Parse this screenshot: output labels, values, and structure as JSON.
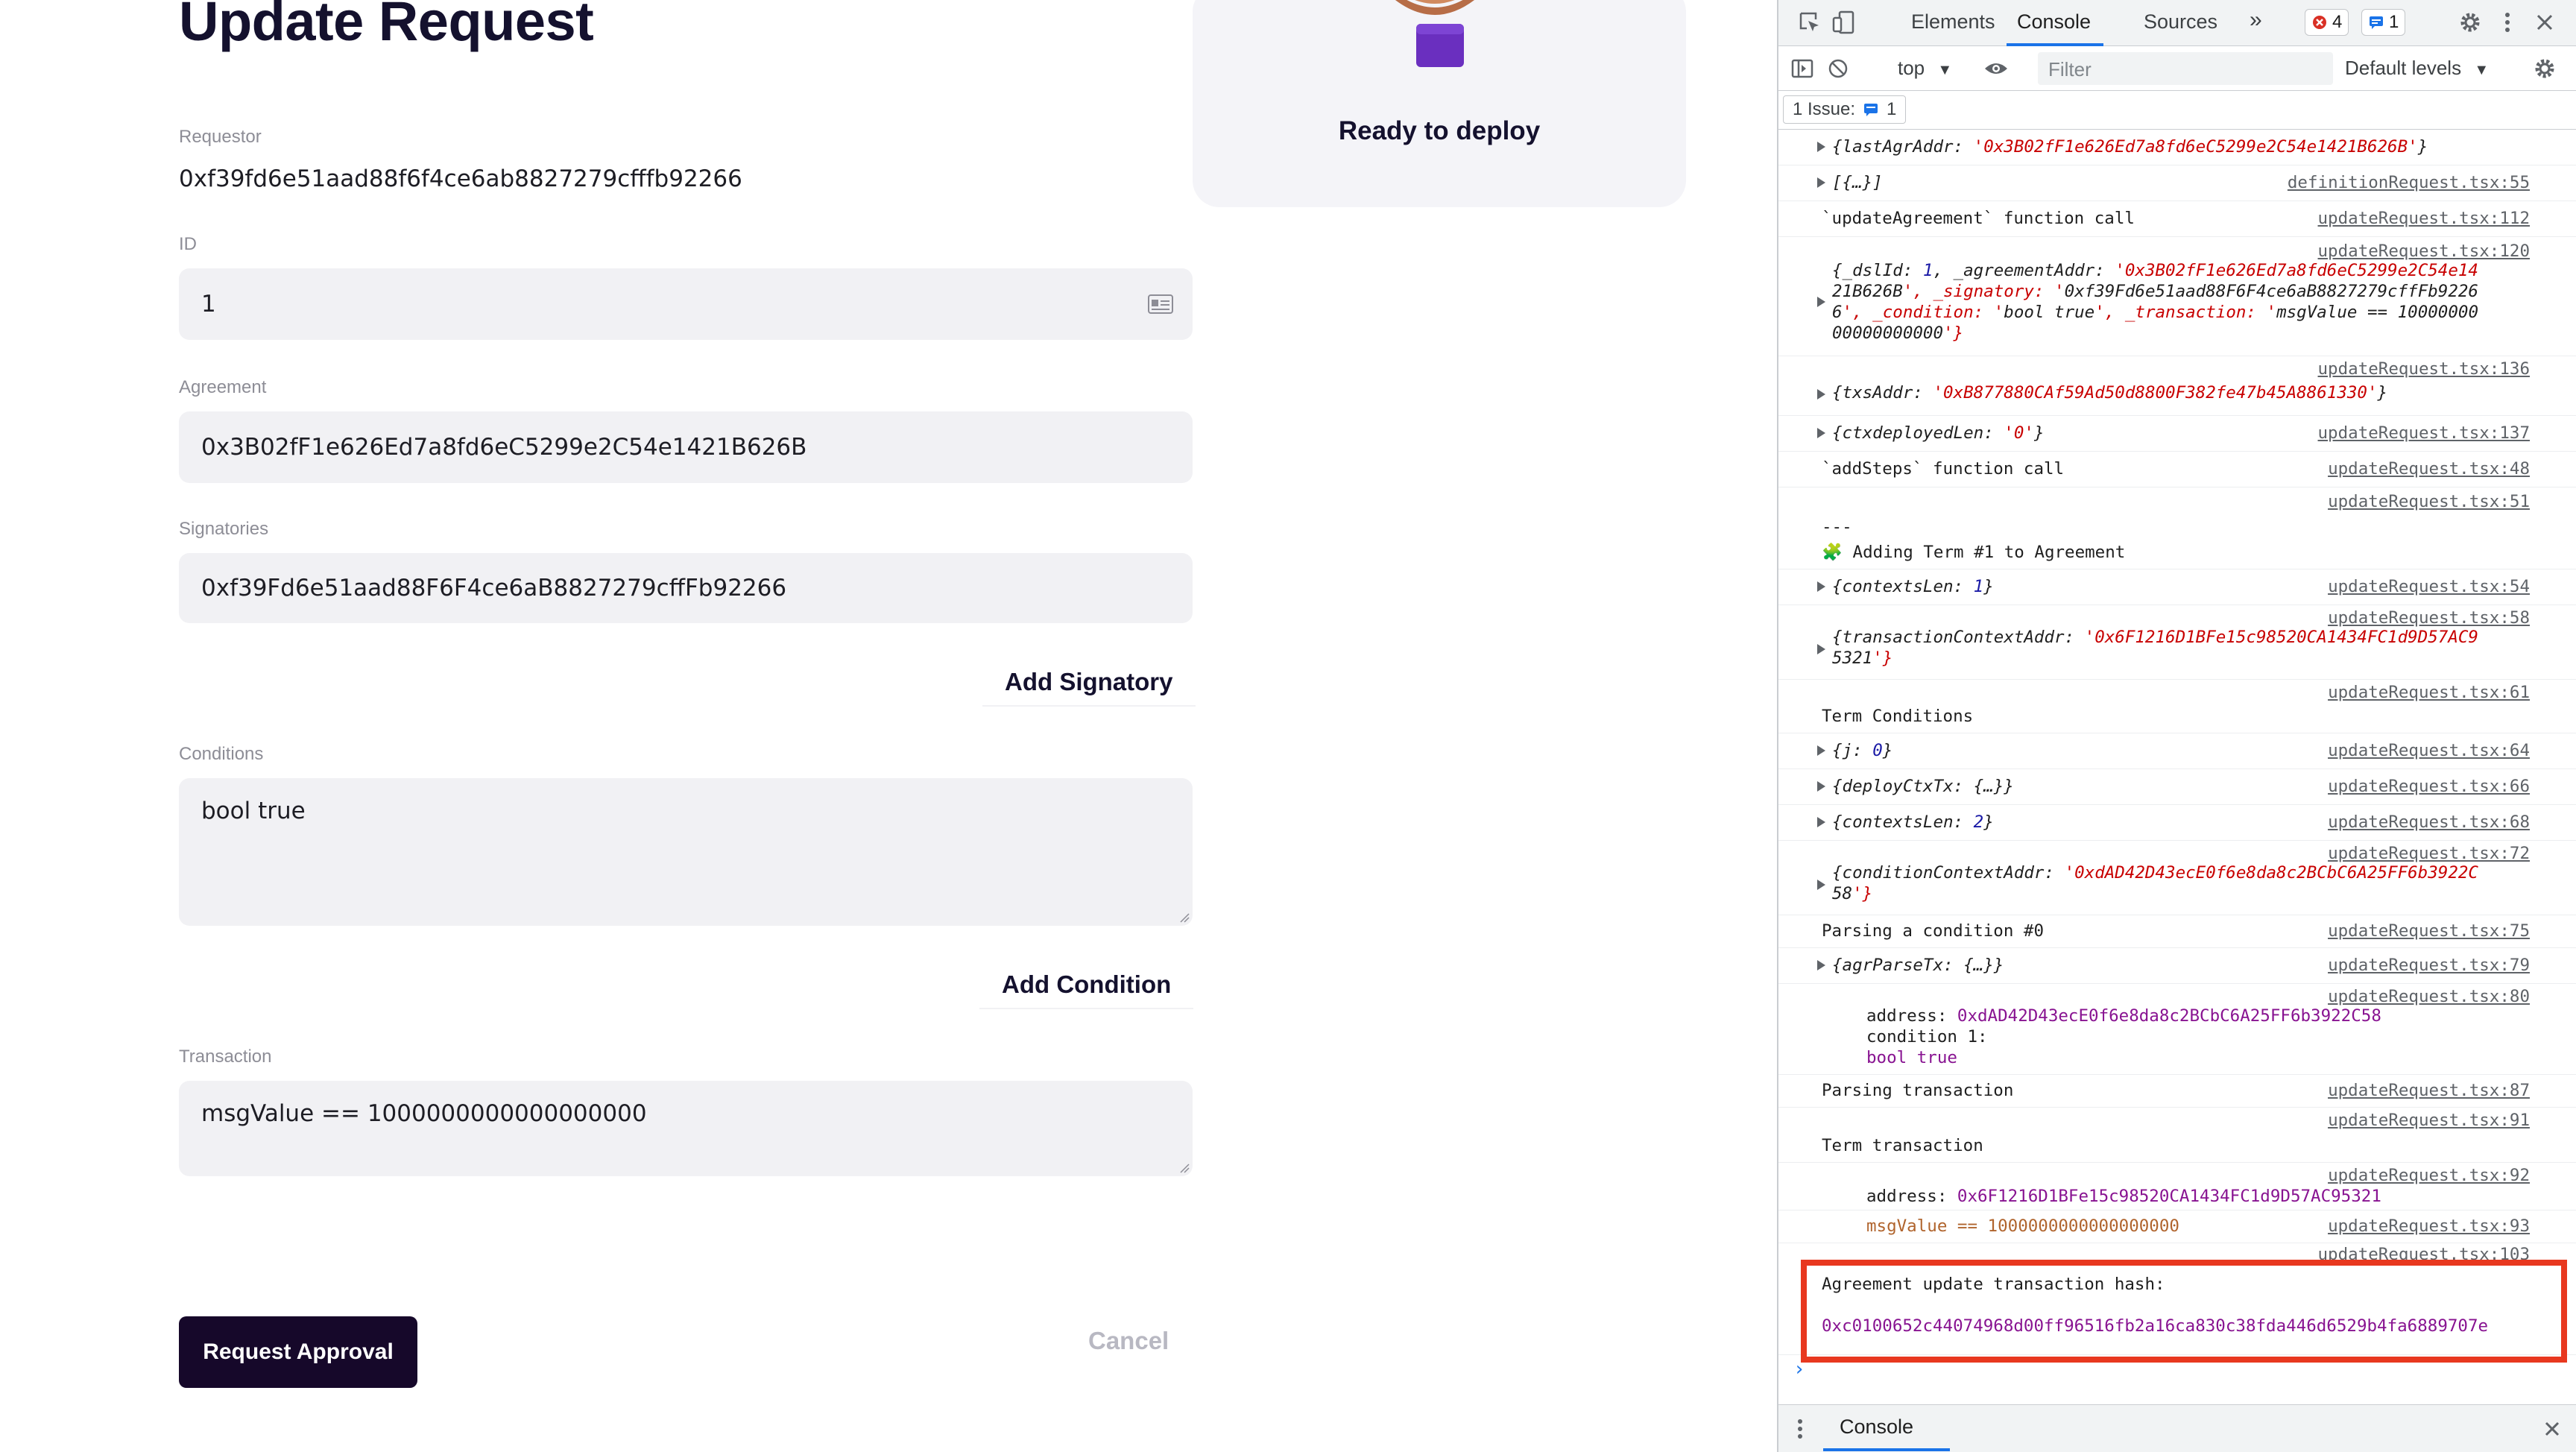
{
  "form": {
    "title": "Update Request",
    "requestor_label": "Requestor",
    "requestor_value": "0xf39fd6e51aad88f6f4ce6ab8827279cfffb92266",
    "id_label": "ID",
    "id_value": "1",
    "agreement_label": "Agreement",
    "agreement_value": "0x3B02fF1e626Ed7a8fd6eC5299e2C54e1421B626B",
    "signatories_label": "Signatories",
    "signatories_value": "0xf39Fd6e51aad88F6F4ce6aB8827279cffFb92266",
    "add_signatory_label": "Add Signatory",
    "conditions_label": "Conditions",
    "conditions_value": "bool true",
    "add_condition_label": "Add Condition",
    "transaction_label": "Transaction",
    "transaction_value": "msgValue == 1000000000000000000",
    "request_approval_label": "Request Approval",
    "cancel_label": "Cancel"
  },
  "deploy_card": {
    "status_text": "Ready to deploy"
  },
  "devtools": {
    "tabs": [
      "Elements",
      "Console",
      "Sources"
    ],
    "active_tab": "Console",
    "more_tabs_glyph": "»",
    "errors_count": "4",
    "messages_count": "1",
    "context": "top",
    "filter_placeholder": "Filter",
    "levels": "Default levels",
    "issues_label": "1 Issue:",
    "issues_count": "1",
    "drawer_tab": "Console",
    "accent_color": "#1a73e8",
    "error_color": "#d93025"
  },
  "console": {
    "r1": "{lastAgrAddr: '0x3B02fF1e626Ed7a8fd6eC5299e2C54e1421B626B'}",
    "r2": "[{…}]",
    "r2_src": "definitionRequest.tsx:55",
    "r3": "`updateAgreement` function call",
    "r3_src": "updateRequest.tsx:112",
    "r4_src": "updateRequest.tsx:120",
    "r4_l1": "{_dslId: 1, _agreementAddr: '0x3B02fF1e626Ed7a8fd6eC5299e2C54e14",
    "r4_l2": "21B626B', _signatory: '0xf39Fd6e51aad88F6F4ce6aB8827279cffFb9226",
    "r4_l3": "6', _condition: 'bool true', _transaction: 'msgValue == 10000000",
    "r4_l4": "00000000000'}",
    "r5_src": "updateRequest.tsx:136",
    "r5": "{txsAddr: '0xB877880CAf59Ad50d8800F382fe47b45A8861330'}",
    "r6": "{ctxdeployedLen: '0'}",
    "r6_src": "updateRequest.tsx:137",
    "r7": "`addSteps` function call",
    "r7_src": "updateRequest.tsx:48",
    "r8_src": "updateRequest.tsx:51",
    "r8_l1": "---",
    "r8_l2": "🧩 Adding Term #1 to Agreement",
    "r9": "{contextsLen: 1}",
    "r9_src": "updateRequest.tsx:54",
    "r10_src": "updateRequest.tsx:58",
    "r10_l1": "{transactionContextAddr: '0x6F1216D1BFe15c98520CA1434FC1d9D57AC9",
    "r10_l2": "5321'}",
    "r11_src": "updateRequest.tsx:61",
    "r11": "Term Conditions",
    "r12": "{j: 0}",
    "r12_src": "updateRequest.tsx:64",
    "r13": "{deployCtxTx: {…}}",
    "r13_src": "updateRequest.tsx:66",
    "r14": "{contextsLen: 2}",
    "r14_src": "updateRequest.tsx:68",
    "r15_src": "updateRequest.tsx:72",
    "r15_l1": "{conditionContextAddr: '0xdAD42D43ecE0f6e8da8c2BCbC6A25FF6b3922C",
    "r15_l2": "58'}",
    "r16": "Parsing a condition #0",
    "r16_src": "updateRequest.tsx:75",
    "r17": "{agrParseTx: {…}}",
    "r17_src": "updateRequest.tsx:79",
    "r18_src": "updateRequest.tsx:80",
    "r18_l1_key": "address:",
    "r18_l1_val": "0xdAD42D43ecE0f6e8da8c2BCbC6A25FF6b3922C58",
    "r18_l2": "condition 1:",
    "r18_l3": "bool true",
    "r19": "Parsing transaction",
    "r19_src": "updateRequest.tsx:87",
    "r20_src": "updateRequest.tsx:91",
    "r20": "Term transaction",
    "r21_src": "updateRequest.tsx:92",
    "r21_key": "address:",
    "r21_val": "0x6F1216D1BFe15c98520CA1434FC1d9D57AC95321",
    "r22": "msgValue == 1000000000000000000",
    "r22_src": "updateRequest.tsx:93",
    "r23_src": "updateRequest.tsx:103",
    "r23_l1": "Agreement update transaction hash:",
    "r23_l2": "0xc0100652c44074968d00ff96516fb2a16ca830c38fda446d6529b4fa6889707e",
    "prompt": "›"
  }
}
